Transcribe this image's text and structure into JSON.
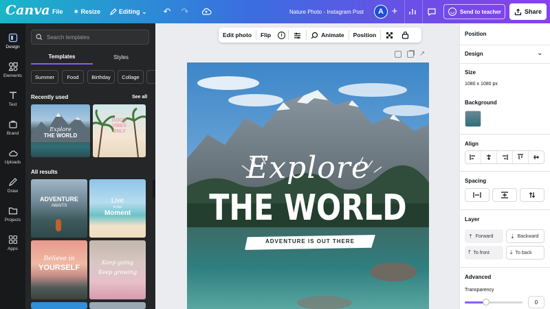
{
  "topbar": {
    "logo": "Canva",
    "file": "File",
    "resize": "Resize",
    "editing": "Editing",
    "doc_title": "Nature Photo - Instagram Post",
    "avatar_initial": "A",
    "send_teacher": "Send to teacher",
    "share": "Share"
  },
  "rail": {
    "items": [
      {
        "label": "Design",
        "icon": "design-icon"
      },
      {
        "label": "Elements",
        "icon": "elements-icon"
      },
      {
        "label": "Text",
        "icon": "text-icon"
      },
      {
        "label": "Brand",
        "icon": "brand-icon"
      },
      {
        "label": "Uploads",
        "icon": "uploads-icon"
      },
      {
        "label": "Draw",
        "icon": "draw-icon"
      },
      {
        "label": "Projects",
        "icon": "projects-icon"
      },
      {
        "label": "Apps",
        "icon": "apps-icon"
      }
    ]
  },
  "panel": {
    "search_placeholder": "Search templates",
    "tabs": [
      "Templates",
      "Styles"
    ],
    "chips": [
      "Summer",
      "Food",
      "Birthday",
      "Collage"
    ],
    "recently_used": "Recently used",
    "see_all": "See all",
    "all_results": "All results",
    "recent": [
      {
        "line1": "Explore",
        "line2": "THE WORLD"
      },
      {
        "line1": "GOOD",
        "line2": "VIBES",
        "line3": "ONLY"
      }
    ],
    "results": [
      {
        "line1": "ADVENTURE",
        "line2": "AWAITS"
      },
      {
        "line1": "Live",
        "line2": "in the",
        "line3": "Moment"
      },
      {
        "line1": "Believe in",
        "line2": "YOURSELF"
      },
      {
        "line1": "Keep going",
        "line2": "Keep growing"
      }
    ]
  },
  "toolbar": {
    "edit_photo": "Edit photo",
    "flip": "Flip",
    "animate": "Animate",
    "position": "Position"
  },
  "design": {
    "script_text": "Explore",
    "headline": "THE WORLD",
    "tagline": "ADVENTURE IS OUT THERE"
  },
  "rpanel": {
    "title": "Position",
    "design_label": "Design",
    "size_label": "Size",
    "size_value": "1080 x 1080 px",
    "background_label": "Background",
    "align_label": "Align",
    "spacing_label": "Spacing",
    "layer_label": "Layer",
    "forward": "Forward",
    "backward": "Backward",
    "to_front": "To front",
    "to_back": "To back",
    "advanced_label": "Advanced",
    "transparency_label": "Transparency",
    "transparency_value": "0"
  },
  "colors": {
    "accent": "#8b5cf6",
    "panel_dark": "#252627",
    "rail": "#18191b"
  }
}
